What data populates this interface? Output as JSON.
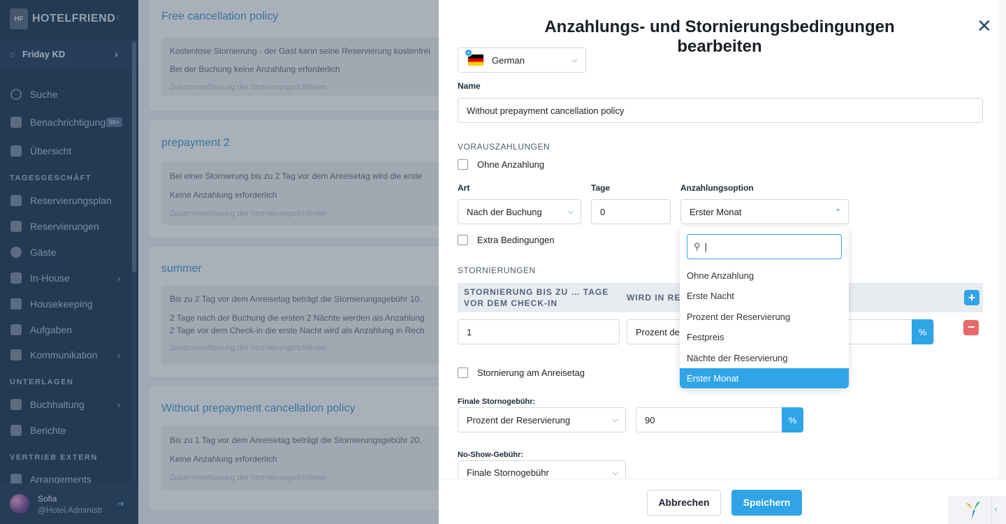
{
  "sidebar": {
    "logo_text": "HOTELFRIEND",
    "logo_mark": "HF",
    "hotel": "Friday KD",
    "nav": {
      "search": "Suche",
      "notifications": "Benachrichtigungen",
      "notifications_badge": "99+",
      "overview": "Übersicht",
      "section_daily": "TAGESGESCHÄFT",
      "reservation_plan": "Reservierungsplan",
      "reservations": "Reservierungen",
      "guests": "Gäste",
      "in_house": "In-House",
      "housekeeping": "Housekeeping",
      "tasks": "Aufgaben",
      "communication": "Kommunikation",
      "section_docs": "UNTERLAGEN",
      "accounting": "Buchhaltung",
      "reports": "Berichte",
      "section_external": "VERTRIEB EXTERN",
      "arrangements": "Arrangements"
    },
    "user": {
      "name": "Sofia",
      "role": "@Hotel Administr"
    }
  },
  "policies": [
    {
      "title": "Free cancellation policy",
      "line1": "Kostenlose Stornierung - der Gast kann seine Reservierung kostenfrei",
      "line2": "Bei der Buchung keine Anzahlung erforderlich",
      "summary": "Zusammenfassung der Stornierungsrichtlinien"
    },
    {
      "title": "prepayment 2",
      "line1": "Bei einer Stornierung bis zu 2 Tag vor dem Anreisetag wird die erste",
      "line2": "Keine Anzahlung erforderlich",
      "summary": "Zusammenfassung der Stornierungsrichtlinien"
    },
    {
      "title": "summer",
      "line1": "Bis zu 2 Tag vor dem Anreisetag beträgt die Stornierungsgebühr 10.",
      "line2": "2 Tage nach der Buchung die ersten 2 Nächte werden als Anzahlung",
      "line3": "2 Tage vor dem Check-in die erste Nacht wird als Anzahlung in Rech",
      "summary": "Zusammenfassung der Stornierungsrichtlinien"
    },
    {
      "title": "Without prepayment cancellation policy",
      "line1": "Bis zu 1 Tag vor dem Anreisetag beträgt die Stornierungsgebühr 20.",
      "line2": "Keine Anzahlung erforderlich",
      "summary": "Zusammenfassung der Stornierungsrichtlinien"
    }
  ],
  "modal": {
    "title": "Anzahlungs- und Stornierungsbedingungen bearbeiten",
    "language": "German",
    "name_label": "Name",
    "name_value": "Without prepayment cancellation policy",
    "section_prepayments": "VORAUSZAHLUNGEN",
    "no_prepayment": "Ohne Anzahlung",
    "type_label": "Art",
    "type_value": "Nach der Buchung",
    "days_label": "Tage",
    "days_value": "0",
    "option_label": "Anzahlungsoption",
    "option_value": "Erster Monat",
    "extra_conditions": "Extra Bedingungen",
    "section_cancellations": "STORNIERUNGEN",
    "col1_line1": "STORNIERUNG BIS ZU … TAGE",
    "col1_line2": "VOR DEM CHECK-IN",
    "col2": "WIRD IN REC",
    "row_days": "1",
    "row_type": "Prozent der",
    "percent": "%",
    "cancel_on_arrival": "Stornierung am Anreisetag",
    "final_fee_label": "Finale Stornogebühr:",
    "final_fee_type": "Prozent der Reservierung",
    "final_fee_value": "90",
    "noshow_label": "No-Show-Gebühr:",
    "noshow_value": "Finale Stornogebühr",
    "cancel_button": "Abbrechen",
    "save_button": "Speichern",
    "dropdown": {
      "search_value": "|",
      "options": [
        "Ohne Anzahlung",
        "Erste Nacht",
        "Prozent der Reservierung",
        "Festpreis",
        "Nächte der Reservierung",
        "Erster Monat"
      ],
      "selected": "Erster Monat"
    }
  },
  "colors": {
    "accent": "#2fa4e7",
    "sidebar": "#26415f",
    "danger": "#e66a6a"
  }
}
